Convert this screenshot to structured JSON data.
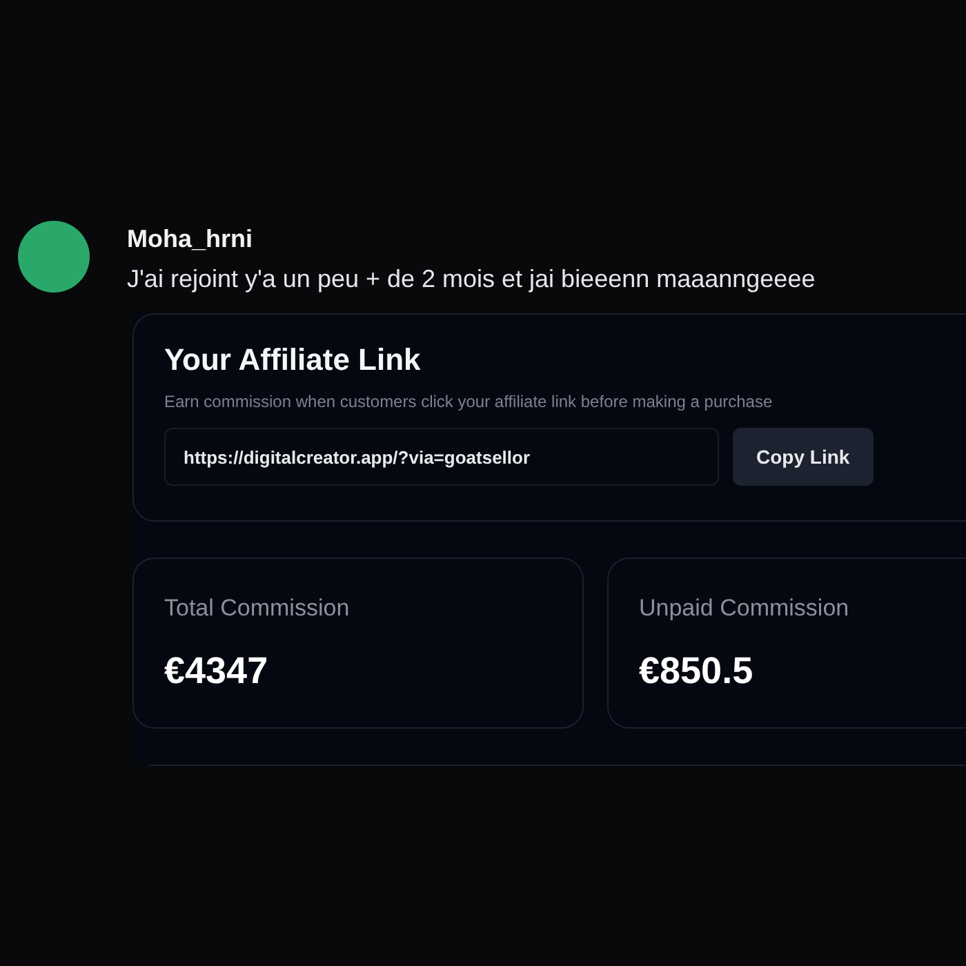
{
  "message": {
    "author": "Moha_hrni",
    "text": "J'ai rejoint y'a un peu + de 2 mois et jai bieeenn maaanngeeee"
  },
  "affiliate": {
    "title": "Your Affiliate Link",
    "subtitle": "Earn commission when customers click your affiliate link before making a purchase",
    "link": "https://digitalcreator.app/?via=goatsellor",
    "button": "Copy Link"
  },
  "stats": [
    {
      "label": "Total Commission",
      "value": "€4347"
    },
    {
      "label": "Unpaid Commission",
      "value": "€850.5"
    }
  ]
}
